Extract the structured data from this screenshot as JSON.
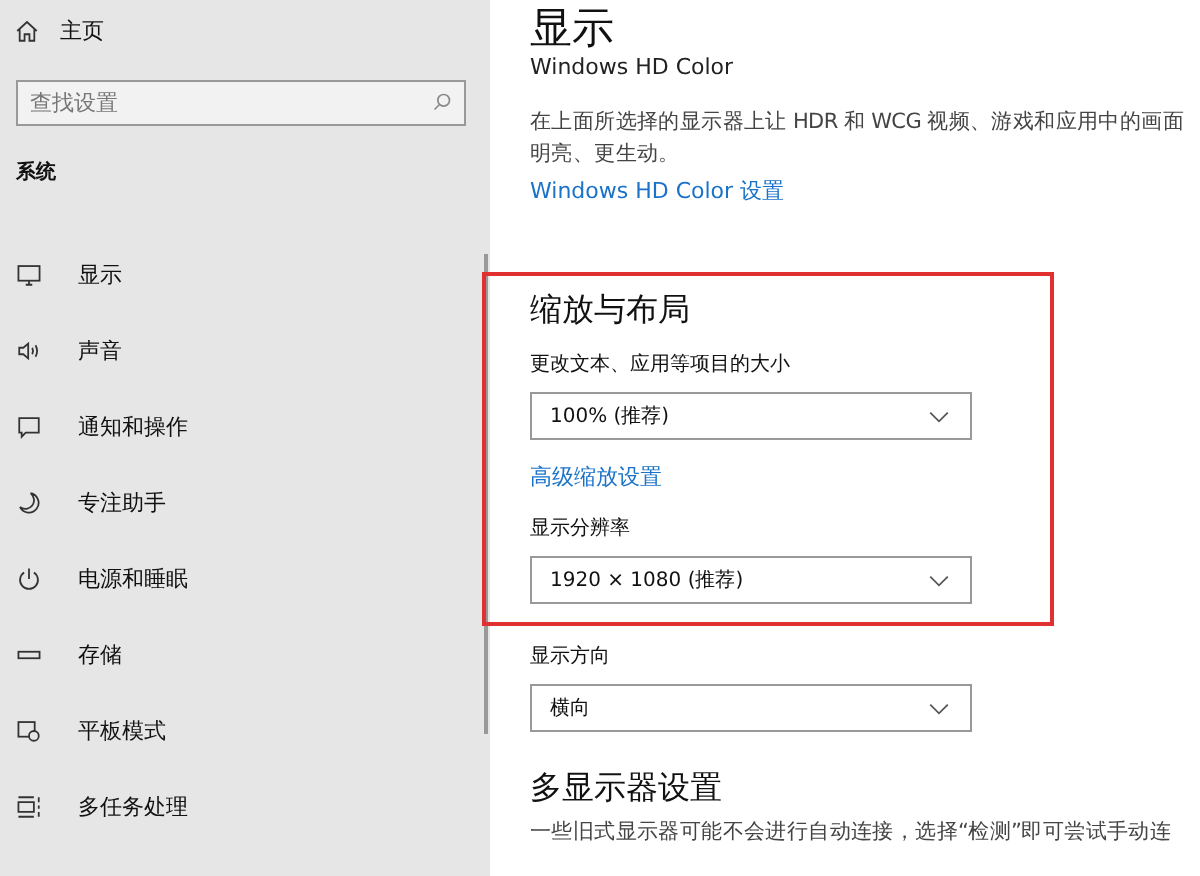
{
  "sidebar": {
    "home": "主页",
    "search": {
      "placeholder": "查找设置"
    },
    "section": "系统",
    "items": [
      {
        "label": "显示"
      },
      {
        "label": "声音"
      },
      {
        "label": "通知和操作"
      },
      {
        "label": "专注助手"
      },
      {
        "label": "电源和睡眠"
      },
      {
        "label": "存储"
      },
      {
        "label": "平板模式"
      },
      {
        "label": "多任务处理"
      }
    ]
  },
  "main": {
    "title": "显示",
    "hdr": {
      "heading": "Windows HD Color",
      "text": "在上面所选择的显示器上让 HDR 和 WCG 视频、游戏和应用中的画面",
      "text_2": "明亮、更生动。",
      "link": "Windows HD Color 设置"
    },
    "scale": {
      "heading": "缩放与布局",
      "size_label": "更改文本、应用等项目的大小",
      "size_value": "100% (推荐)",
      "advanced_link": "高级缩放设置",
      "resolution_label": "显示分辨率",
      "resolution_value": "1920 × 1080 (推荐)",
      "orientation_label": "显示方向",
      "orientation_value": "横向"
    },
    "multi": {
      "heading": "多显示器设置",
      "text": "一些旧式显示器可能不会进行自动连接，选择“检测”即可尝试手动连"
    }
  }
}
